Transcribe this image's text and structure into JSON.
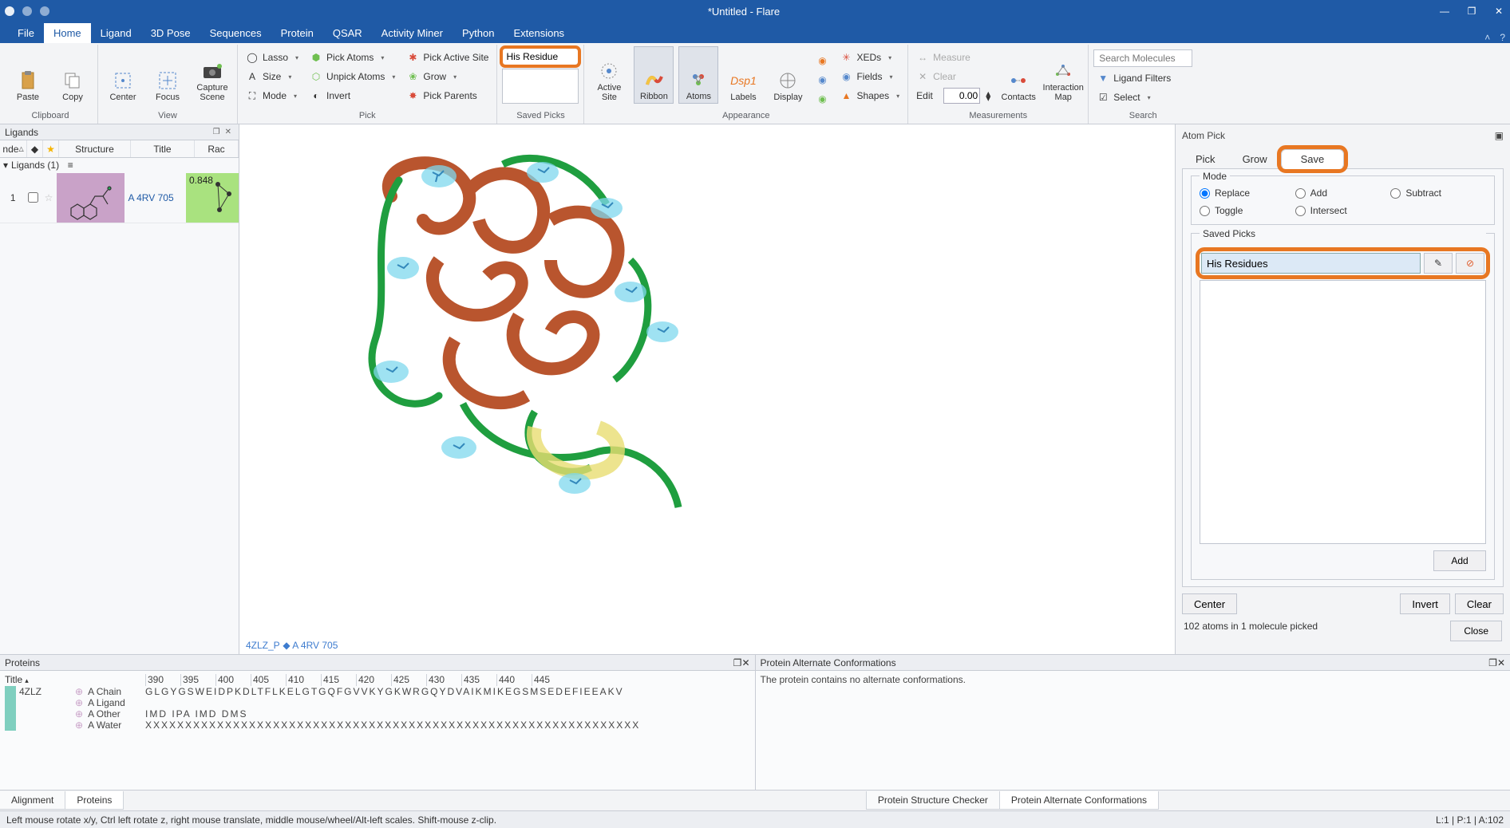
{
  "window": {
    "title": "*Untitled - Flare",
    "controls": [
      "min",
      "max",
      "close"
    ]
  },
  "menu": [
    "File",
    "Home",
    "Ligand",
    "3D Pose",
    "Sequences",
    "Protein",
    "QSAR",
    "Activity Miner",
    "Python",
    "Extensions"
  ],
  "menu_active": "Home",
  "ribbon": {
    "clipboard": {
      "label": "Clipboard",
      "paste": "Paste",
      "copy": "Copy"
    },
    "view": {
      "label": "View",
      "center": "Center",
      "focus": "Focus",
      "capture": "Capture Scene"
    },
    "pick": {
      "label": "Pick",
      "lasso": "Lasso",
      "size": "Size",
      "mode": "Mode",
      "pick_atoms": "Pick Atoms",
      "unpick_atoms": "Unpick Atoms",
      "invert": "Invert",
      "pick_active": "Pick Active Site",
      "grow": "Grow",
      "pick_parents": "Pick Parents"
    },
    "saved_picks": {
      "label": "Saved Picks",
      "value": "His Residue"
    },
    "appearance": {
      "label": "Appearance",
      "active_site": "Active Site",
      "ribbon": "Ribbon",
      "atoms": "Atoms",
      "labels": "Labels",
      "display": "Display",
      "xeds": "XEDs",
      "fields": "Fields",
      "shapes": "Shapes"
    },
    "measurements": {
      "label": "Measurements",
      "measure": "Measure",
      "clear": "Clear",
      "edit": "Edit",
      "value": "0.00",
      "contacts": "Contacts",
      "interaction_map": "Interaction Map"
    },
    "search": {
      "label": "Search",
      "placeholder": "Search Molecules",
      "ligand_filters": "Ligand Filters",
      "select": "Select"
    }
  },
  "ligands_panel": {
    "title": "Ligands",
    "headers": {
      "index": "nde",
      "structure": "Structure",
      "title": "Title",
      "rac": "Rac"
    },
    "tree_root": "Ligands (1)",
    "rows": [
      {
        "index": "1",
        "title": "A 4RV 705",
        "rac": "0.848"
      }
    ]
  },
  "view3d": {
    "caption_1": "4ZLZ_P",
    "caption_2": "A 4RV 705"
  },
  "atom_pick": {
    "title": "Atom Pick",
    "tabs": [
      "Pick",
      "Grow",
      "Save"
    ],
    "active_tab": "Save",
    "mode_label": "Mode",
    "modes": [
      "Replace",
      "Add",
      "Subtract",
      "Toggle",
      "Intersect"
    ],
    "mode_selected": "Replace",
    "saved_label": "Saved Picks",
    "saved_value": "His Residues",
    "add": "Add",
    "center": "Center",
    "invert": "Invert",
    "clear": "Clear",
    "close": "Close",
    "status": "102 atoms in 1 molecule picked"
  },
  "proteins_panel": {
    "title": "Proteins",
    "col_title": "Title",
    "protein": "4ZLZ",
    "chains": [
      "A Chain",
      "A Ligand",
      "A Other",
      "A Water"
    ],
    "ticks": [
      "390",
      "395",
      "400",
      "405",
      "410",
      "415",
      "420",
      "425",
      "430",
      "435",
      "440",
      "445"
    ],
    "seq_chain": "GLGYGSWEIDPKDLTFLKELGTGQFGVVKYGKWRGQYDVAIKMIKEGSMSEDEFIEEAKV",
    "seq_other": "IMD IPA IMD DMS",
    "seq_water": "XXXXXXXXXXXXXXXXXXXXXXXXXXXXXXXXXXXXXXXXXXXXXXXXXXXXXXXXXXXXXX"
  },
  "alt_conf": {
    "title": "Protein Alternate Conformations",
    "text": "The protein contains no alternate conformations."
  },
  "bottom_tabs_left": [
    "Alignment",
    "Proteins"
  ],
  "bottom_tabs_right": [
    "Protein Structure Checker",
    "Protein Alternate Conformations"
  ],
  "statusbar": {
    "hint": "Left mouse rotate x/y, Ctrl left rotate z, right mouse translate, middle mouse/wheel/Alt-left scales. Shift-mouse z-clip.",
    "right": "L:1  | P:1  | A:102"
  },
  "colors": {
    "brand": "#1f5aa6",
    "highlight": "#e87722"
  }
}
